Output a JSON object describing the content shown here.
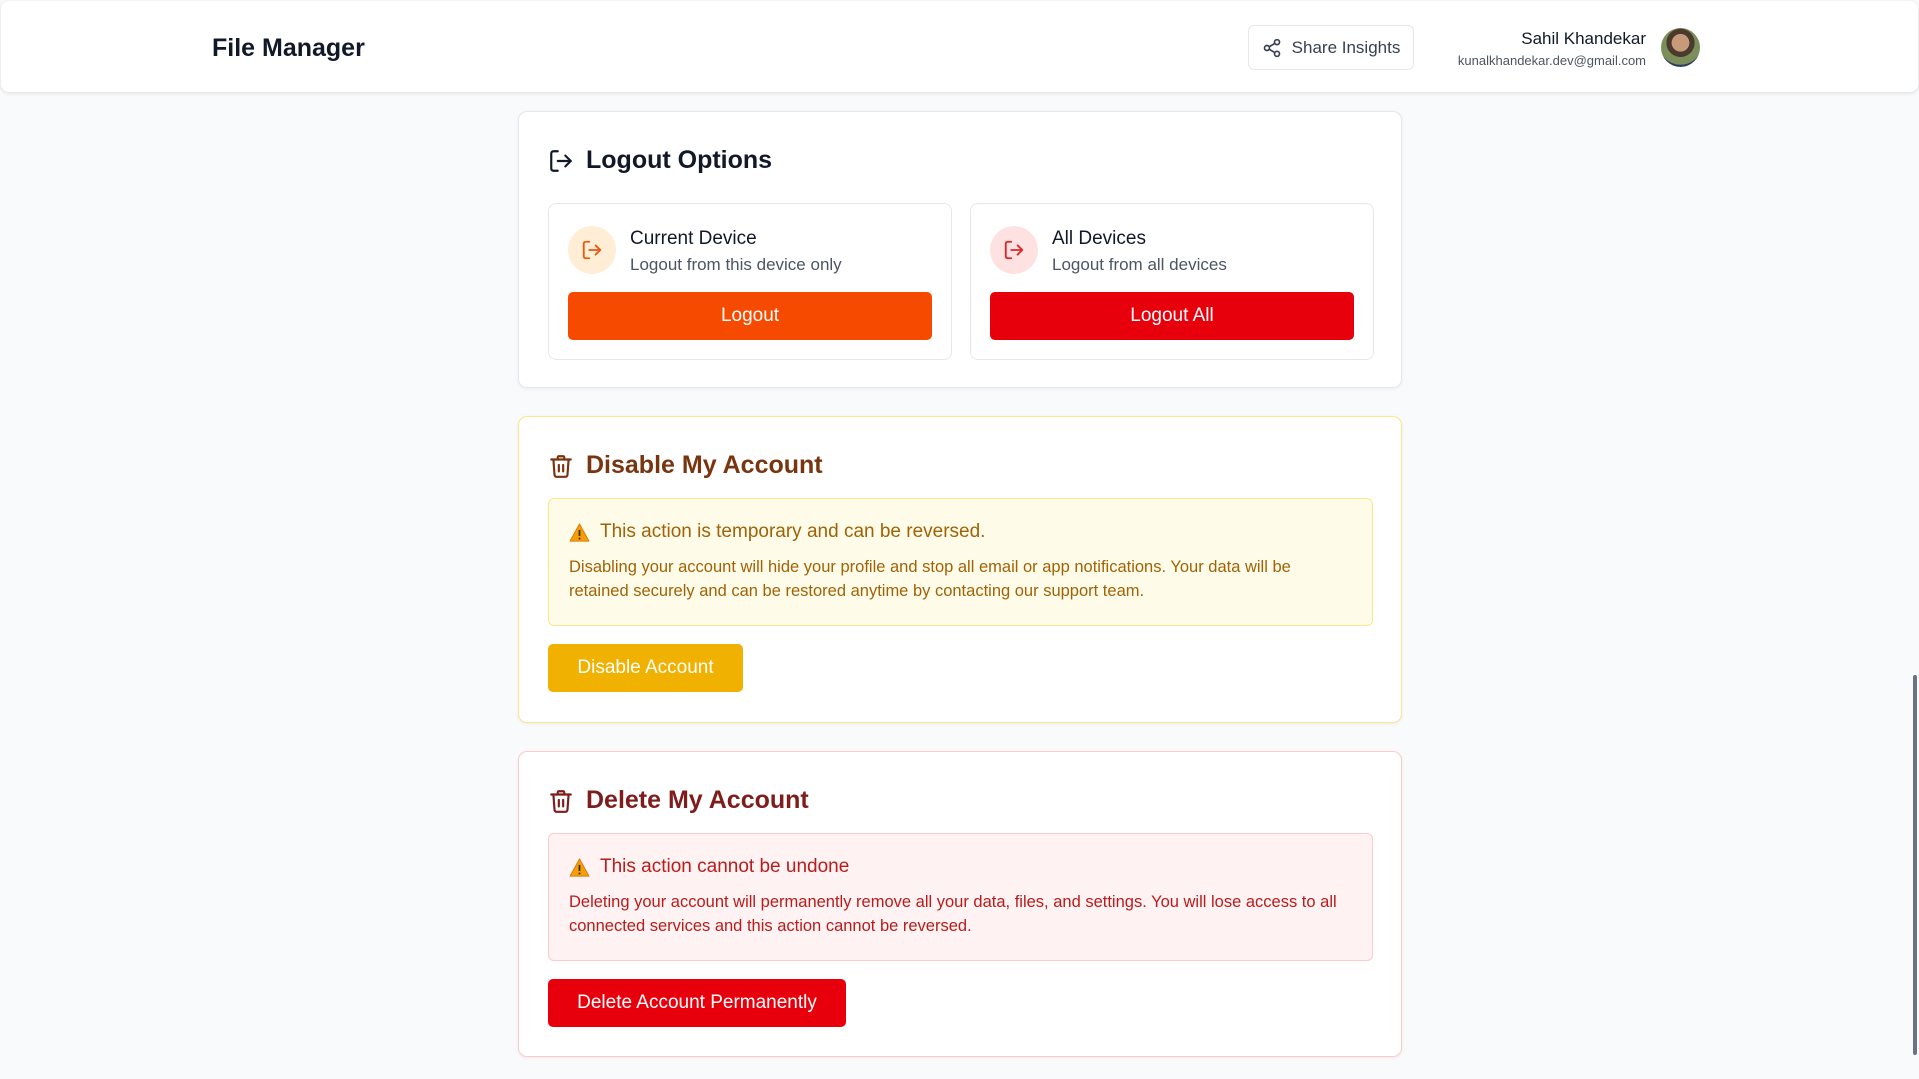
{
  "header": {
    "app_title": "File Manager",
    "share_label": "Share Insights",
    "user_name": "Sahil Khandekar",
    "user_email": "kunalkhandekar.dev@gmail.com"
  },
  "logout": {
    "title": "Logout Options",
    "current": {
      "title": "Current Device",
      "subtitle": "Logout from this device only",
      "button": "Logout"
    },
    "all": {
      "title": "All Devices",
      "subtitle": "Logout from all devices",
      "button": "Logout All"
    }
  },
  "disable": {
    "title": "Disable My Account",
    "notice_title": "This action is temporary and can be reversed.",
    "notice_body": "Disabling your account will hide your profile and stop all email or app notifications. Your data will be retained securely and can be restored anytime by contacting our support team.",
    "button": "Disable Account"
  },
  "delete": {
    "title": "Delete My Account",
    "notice_title": "This action cannot be undone",
    "notice_body": "Deleting your account will permanently remove all your data, files, and settings. You will lose access to all connected services and this action cannot be reversed.",
    "button": "Delete Account Permanently"
  },
  "colors": {
    "logout_orange": "#f54a00",
    "logout_red": "#e7000b",
    "disable_yellow": "#f0b100",
    "delete_red": "#e7000b"
  }
}
